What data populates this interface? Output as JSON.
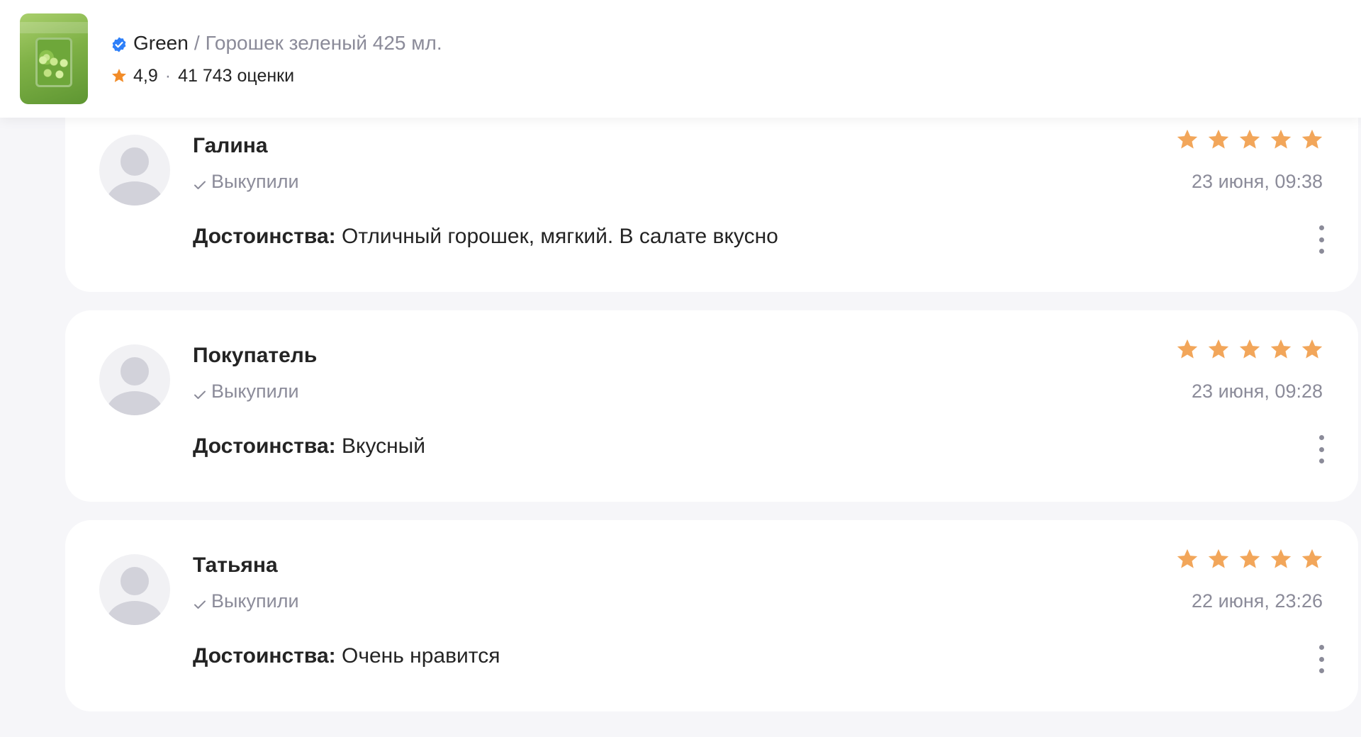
{
  "header": {
    "brand": "Green",
    "separator": "/",
    "product_name": "Горошек зеленый 425 мл.",
    "rating": "4,9",
    "dot": "·",
    "ratings_count": "41 743 оценки",
    "thumbnail_icon": "product-image"
  },
  "colors": {
    "star": "#f2a65a",
    "verified": "#2d7ff9",
    "muted_text": "#8b8b99",
    "card_bg": "#ffffff",
    "page_bg": "#f6f6f9"
  },
  "reviews": [
    {
      "author": "Галина",
      "purchased": "Выкупили",
      "stars": 5,
      "date": "23 июня, 09:38",
      "label": "Достоинства:",
      "text": "Отличный горошек, мягкий. В салате вкусно"
    },
    {
      "author": "Покупатель",
      "purchased": "Выкупили",
      "stars": 5,
      "date": "23 июня, 09:28",
      "label": "Достоинства:",
      "text": "Вкусный"
    },
    {
      "author": "Татьяна",
      "purchased": "Выкупили",
      "stars": 5,
      "date": "22 июня, 23:26",
      "label": "Достоинства:",
      "text": "Очень нравится"
    }
  ]
}
